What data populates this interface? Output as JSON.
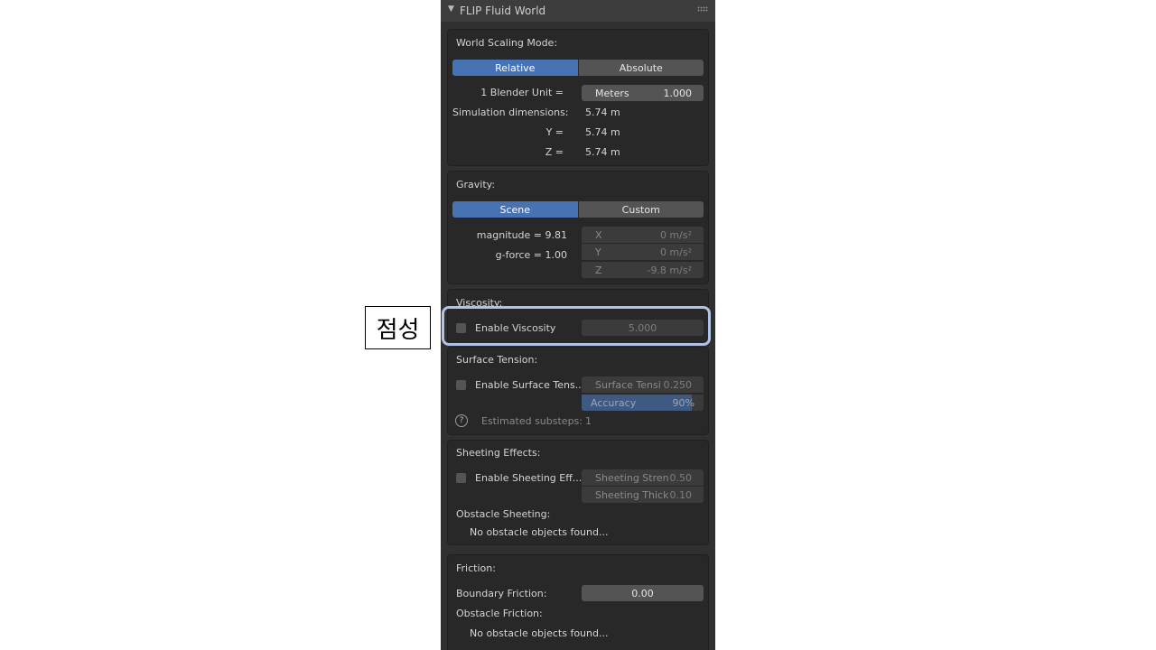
{
  "panel": {
    "title": "FLIP Fluid World"
  },
  "world_scaling": {
    "heading": "World Scaling Mode:",
    "modes": [
      "Relative",
      "Absolute"
    ],
    "active_mode": "Relative",
    "blender_unit_label": "1 Blender Unit =",
    "unit_name": "Meters",
    "unit_value": "1.000",
    "sim_dims_label": "Simulation dimensions: ...",
    "x_value": "5.74 m",
    "y_label": "Y =",
    "y_value": "5.74 m",
    "z_label": "Z =",
    "z_value": "5.74 m"
  },
  "gravity": {
    "heading": "Gravity:",
    "modes": [
      "Scene",
      "Custom"
    ],
    "active_mode": "Scene",
    "magnitude": "magnitude = 9.81",
    "gforce": "g-force = 1.00",
    "x_label": "X",
    "x_value": "0 m/s²",
    "y_label": "Y",
    "y_value": "0 m/s²",
    "z_label": "Z",
    "z_value": "-9.8 m/s²"
  },
  "viscosity": {
    "heading": "Viscosity:",
    "checkbox_label": "Enable Viscosity",
    "value": "5.000"
  },
  "surface_tension": {
    "heading": "Surface Tension:",
    "checkbox_label": "Enable Surface Tens...",
    "tension_label": "Surface Tensi",
    "tension_value": "0.250",
    "accuracy_label": "Accuracy",
    "accuracy_value": "90%",
    "accuracy_fraction": 0.9,
    "substeps_label": "Estimated substeps:",
    "substeps_value": "1"
  },
  "sheeting": {
    "heading": "Sheeting Effects:",
    "checkbox_label": "Enable Sheeting Eff...",
    "strength_label": "Sheeting Stren",
    "strength_value": "0.50",
    "thickness_label": "Sheeting Thick",
    "thickness_value": "0.10",
    "obstacle_heading": "Obstacle Sheeting:",
    "obstacle_note": "No obstacle objects found..."
  },
  "friction": {
    "heading": "Friction:",
    "boundary_label": "Boundary Friction:",
    "boundary_value": "0.00",
    "obstacle_heading": "Obstacle Friction:",
    "obstacle_note": "No obstacle objects found..."
  },
  "annotation": {
    "callout_text": "점성",
    "highlight_color": "#b0c2e6"
  },
  "colors": {
    "accent": "#4772b3",
    "panel_bg": "#303030",
    "box_bg": "#282828"
  },
  "icons": [
    "collapse-triangle-icon",
    "drag-grip-icon",
    "help-icon"
  ]
}
